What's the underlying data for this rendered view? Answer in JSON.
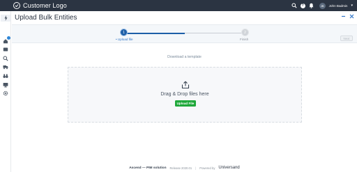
{
  "topbar": {
    "brand": "Customer Logo",
    "user_name": "John Badmin",
    "avatar_initials": "JB",
    "help_glyph": "?",
    "icons": [
      "search-icon",
      "help-icon",
      "bell-icon",
      "avatar",
      "chevron-down-icon"
    ]
  },
  "sidebar": {
    "icons": [
      "bolt-icon",
      "home-icon",
      "inbox-icon",
      "search-icon",
      "truck-icon",
      "binoculars-icon",
      "monitor-icon",
      "gear-icon"
    ]
  },
  "header": {
    "title": "Upload Bulk Entities"
  },
  "stepper": {
    "steps": [
      {
        "number": "1",
        "label": "• Upload file",
        "state": "active"
      },
      {
        "number": "2",
        "label": "Finish",
        "state": "inactive"
      }
    ],
    "next_label": "Next"
  },
  "main": {
    "download_link": "Download a template",
    "dropzone_text": "Drag & Drop files here",
    "upload_button": "Upload File"
  },
  "footer": {
    "product": "Ascend — PIM solution",
    "release": "Release 2020.01",
    "separator": "|",
    "powered_by": "Powered by",
    "brand": "Universand"
  },
  "colors": {
    "topbar": "#2b3442",
    "accent": "#1d5fa8",
    "upload_button": "#1fa83a"
  }
}
